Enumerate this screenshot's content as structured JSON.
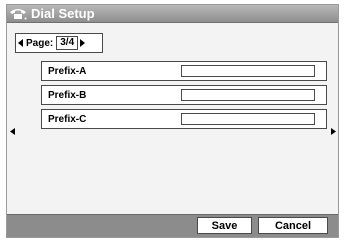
{
  "window": {
    "title": "Dial Setup",
    "icon": "phone-icon"
  },
  "pager": {
    "label": "Page:",
    "value": "3/4",
    "prev_icon": "triangle-left-icon",
    "next_icon": "triangle-right-icon"
  },
  "fields": [
    {
      "label": "Prefix-A",
      "value": ""
    },
    {
      "label": "Prefix-B",
      "value": ""
    },
    {
      "label": "Prefix-C",
      "value": ""
    }
  ],
  "side_nav": {
    "left_icon": "triangle-left-icon",
    "right_icon": "triangle-right-icon"
  },
  "buttons": {
    "save": "Save",
    "cancel": "Cancel"
  }
}
